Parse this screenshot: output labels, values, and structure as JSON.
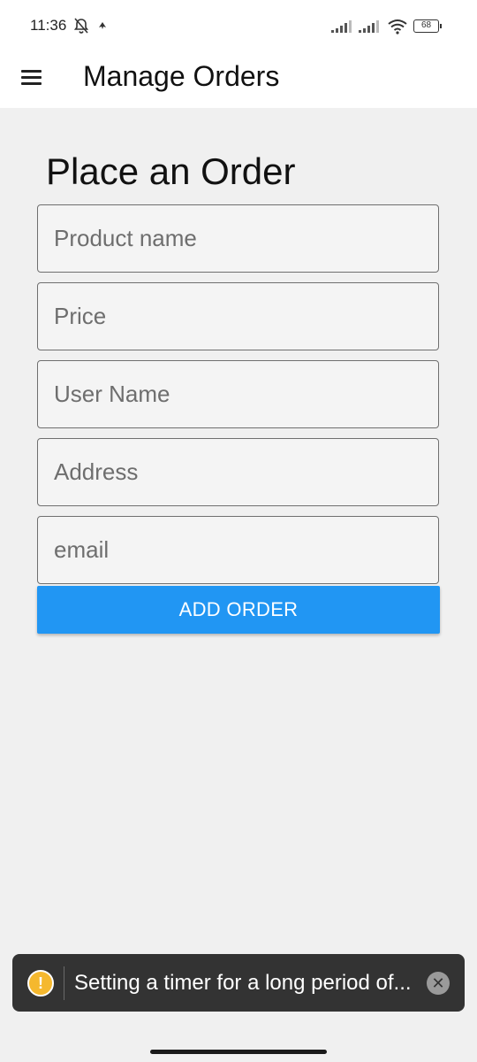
{
  "status_bar": {
    "time": "11:36",
    "battery": "68",
    "icons": [
      "bell-off-icon",
      "charging-arrow-icon",
      "signal-icon",
      "signal-icon",
      "wifi-icon",
      "battery-icon"
    ]
  },
  "app_bar": {
    "menu_icon": "hamburger-menu-icon",
    "title": "Manage Orders"
  },
  "form": {
    "title": "Place an Order",
    "fields": [
      {
        "placeholder": "Product name",
        "value": ""
      },
      {
        "placeholder": "Price",
        "value": ""
      },
      {
        "placeholder": "User Name",
        "value": ""
      },
      {
        "placeholder": "Address",
        "value": ""
      },
      {
        "placeholder": "email",
        "value": ""
      }
    ],
    "submit_label": "ADD ORDER"
  },
  "toast": {
    "icon": "warning-icon",
    "icon_glyph": "!",
    "message": "Setting a timer for a long period of...",
    "close_icon": "close-icon",
    "close_glyph": "✕"
  },
  "colors": {
    "accent": "#2196f3",
    "background": "#f0f0f0",
    "toast_bg": "#333333",
    "warning": "#f5b82e"
  }
}
